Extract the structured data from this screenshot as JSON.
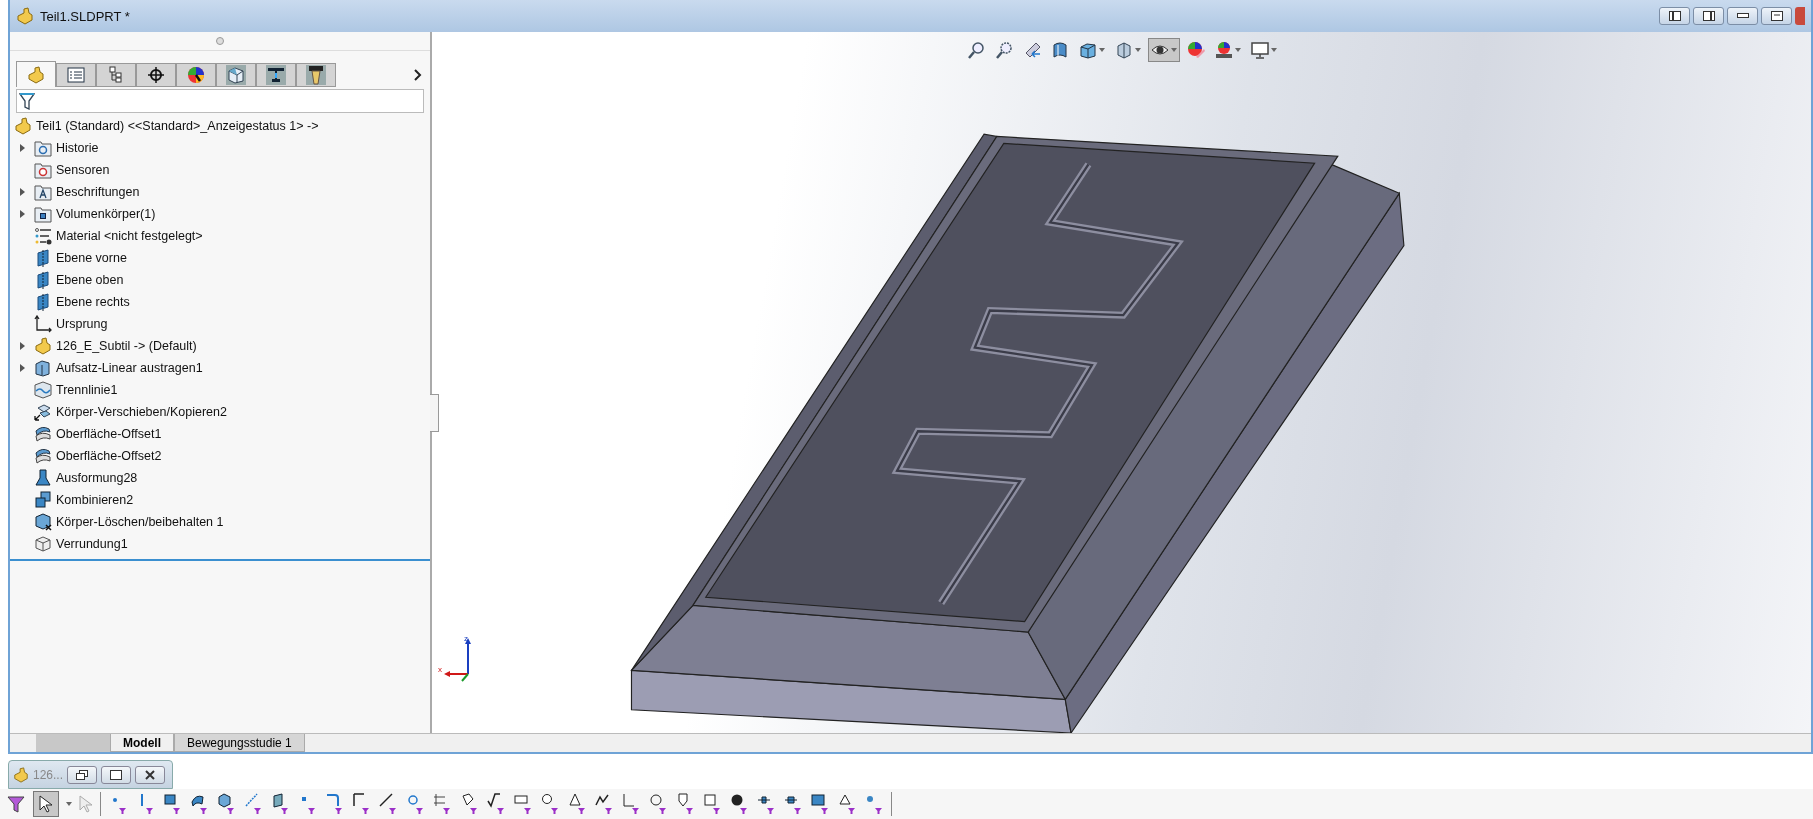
{
  "window": {
    "title": "Teil1.SLDPRT *"
  },
  "panel_tabs": [
    {
      "kind": "feature-tree",
      "selected": true
    },
    {
      "kind": "property",
      "selected": false
    },
    {
      "kind": "config",
      "selected": false
    },
    {
      "kind": "dim",
      "selected": false
    },
    {
      "kind": "appearance",
      "selected": false
    },
    {
      "kind": "cam",
      "selected": false
    },
    {
      "kind": "machine",
      "selected": false
    },
    {
      "kind": "tool",
      "selected": false
    }
  ],
  "tree": {
    "root": "Teil1 (Standard) <<Standard>_Anzeigestatus 1> ->",
    "items": [
      {
        "label": "Historie",
        "kind": "folder-history",
        "expander": true
      },
      {
        "label": "Sensoren",
        "kind": "folder-sensor",
        "expander": false
      },
      {
        "label": "Beschriftungen",
        "kind": "folder-annotation",
        "expander": true
      },
      {
        "label": "Volumenkörper(1)",
        "kind": "folder-solid",
        "expander": true
      },
      {
        "label": "Material <nicht festgelegt>",
        "kind": "material",
        "expander": false
      },
      {
        "label": "Ebene vorne",
        "kind": "plane",
        "expander": false
      },
      {
        "label": "Ebene oben",
        "kind": "plane",
        "expander": false
      },
      {
        "label": "Ebene rechts",
        "kind": "plane",
        "expander": false
      },
      {
        "label": "Ursprung",
        "kind": "origin",
        "expander": false
      },
      {
        "label": "126_E_Subtil -> (Default)",
        "kind": "part",
        "expander": true
      },
      {
        "label": "Aufsatz-Linear austragen1",
        "kind": "extrude",
        "expander": true
      },
      {
        "label": "Trennlinie1",
        "kind": "split",
        "expander": false
      },
      {
        "label": "Körper-Verschieben/Kopieren2",
        "kind": "move",
        "expander": false
      },
      {
        "label": "Oberfläche-Offset1",
        "kind": "offset",
        "expander": false
      },
      {
        "label": "Oberfläche-Offset2",
        "kind": "offset",
        "expander": false
      },
      {
        "label": "Ausformung28",
        "kind": "loft",
        "expander": false
      },
      {
        "label": "Kombinieren2",
        "kind": "combine",
        "expander": false
      },
      {
        "label": "Körper-Löschen/beibehalten 1",
        "kind": "delete",
        "expander": false
      },
      {
        "label": "Verrundung1",
        "kind": "fillet",
        "expander": false
      }
    ]
  },
  "view_toolbar": [
    {
      "kind": "zoom-fit",
      "dropdown": false,
      "selected": false
    },
    {
      "kind": "zoom-area",
      "dropdown": false,
      "selected": false
    },
    {
      "kind": "previous",
      "dropdown": false,
      "selected": false
    },
    {
      "kind": "section",
      "dropdown": false,
      "selected": false
    },
    {
      "kind": "orientation",
      "dropdown": true,
      "selected": false
    },
    {
      "kind": "display-style",
      "dropdown": true,
      "selected": false
    },
    {
      "kind": "hide-show",
      "dropdown": true,
      "selected": true
    },
    {
      "kind": "appearance",
      "dropdown": false,
      "selected": false
    },
    {
      "kind": "scene",
      "dropdown": true,
      "selected": false
    },
    {
      "kind": "monitor",
      "dropdown": true,
      "selected": false
    }
  ],
  "triad": {
    "z": "z",
    "x": "x"
  },
  "bottom_tabs": [
    {
      "label": "Modell",
      "selected": true
    },
    {
      "label": "Bewegungsstudie 1",
      "selected": false
    }
  ],
  "minimized_window": {
    "title": "126..."
  },
  "select_tool": {
    "selected": true
  }
}
